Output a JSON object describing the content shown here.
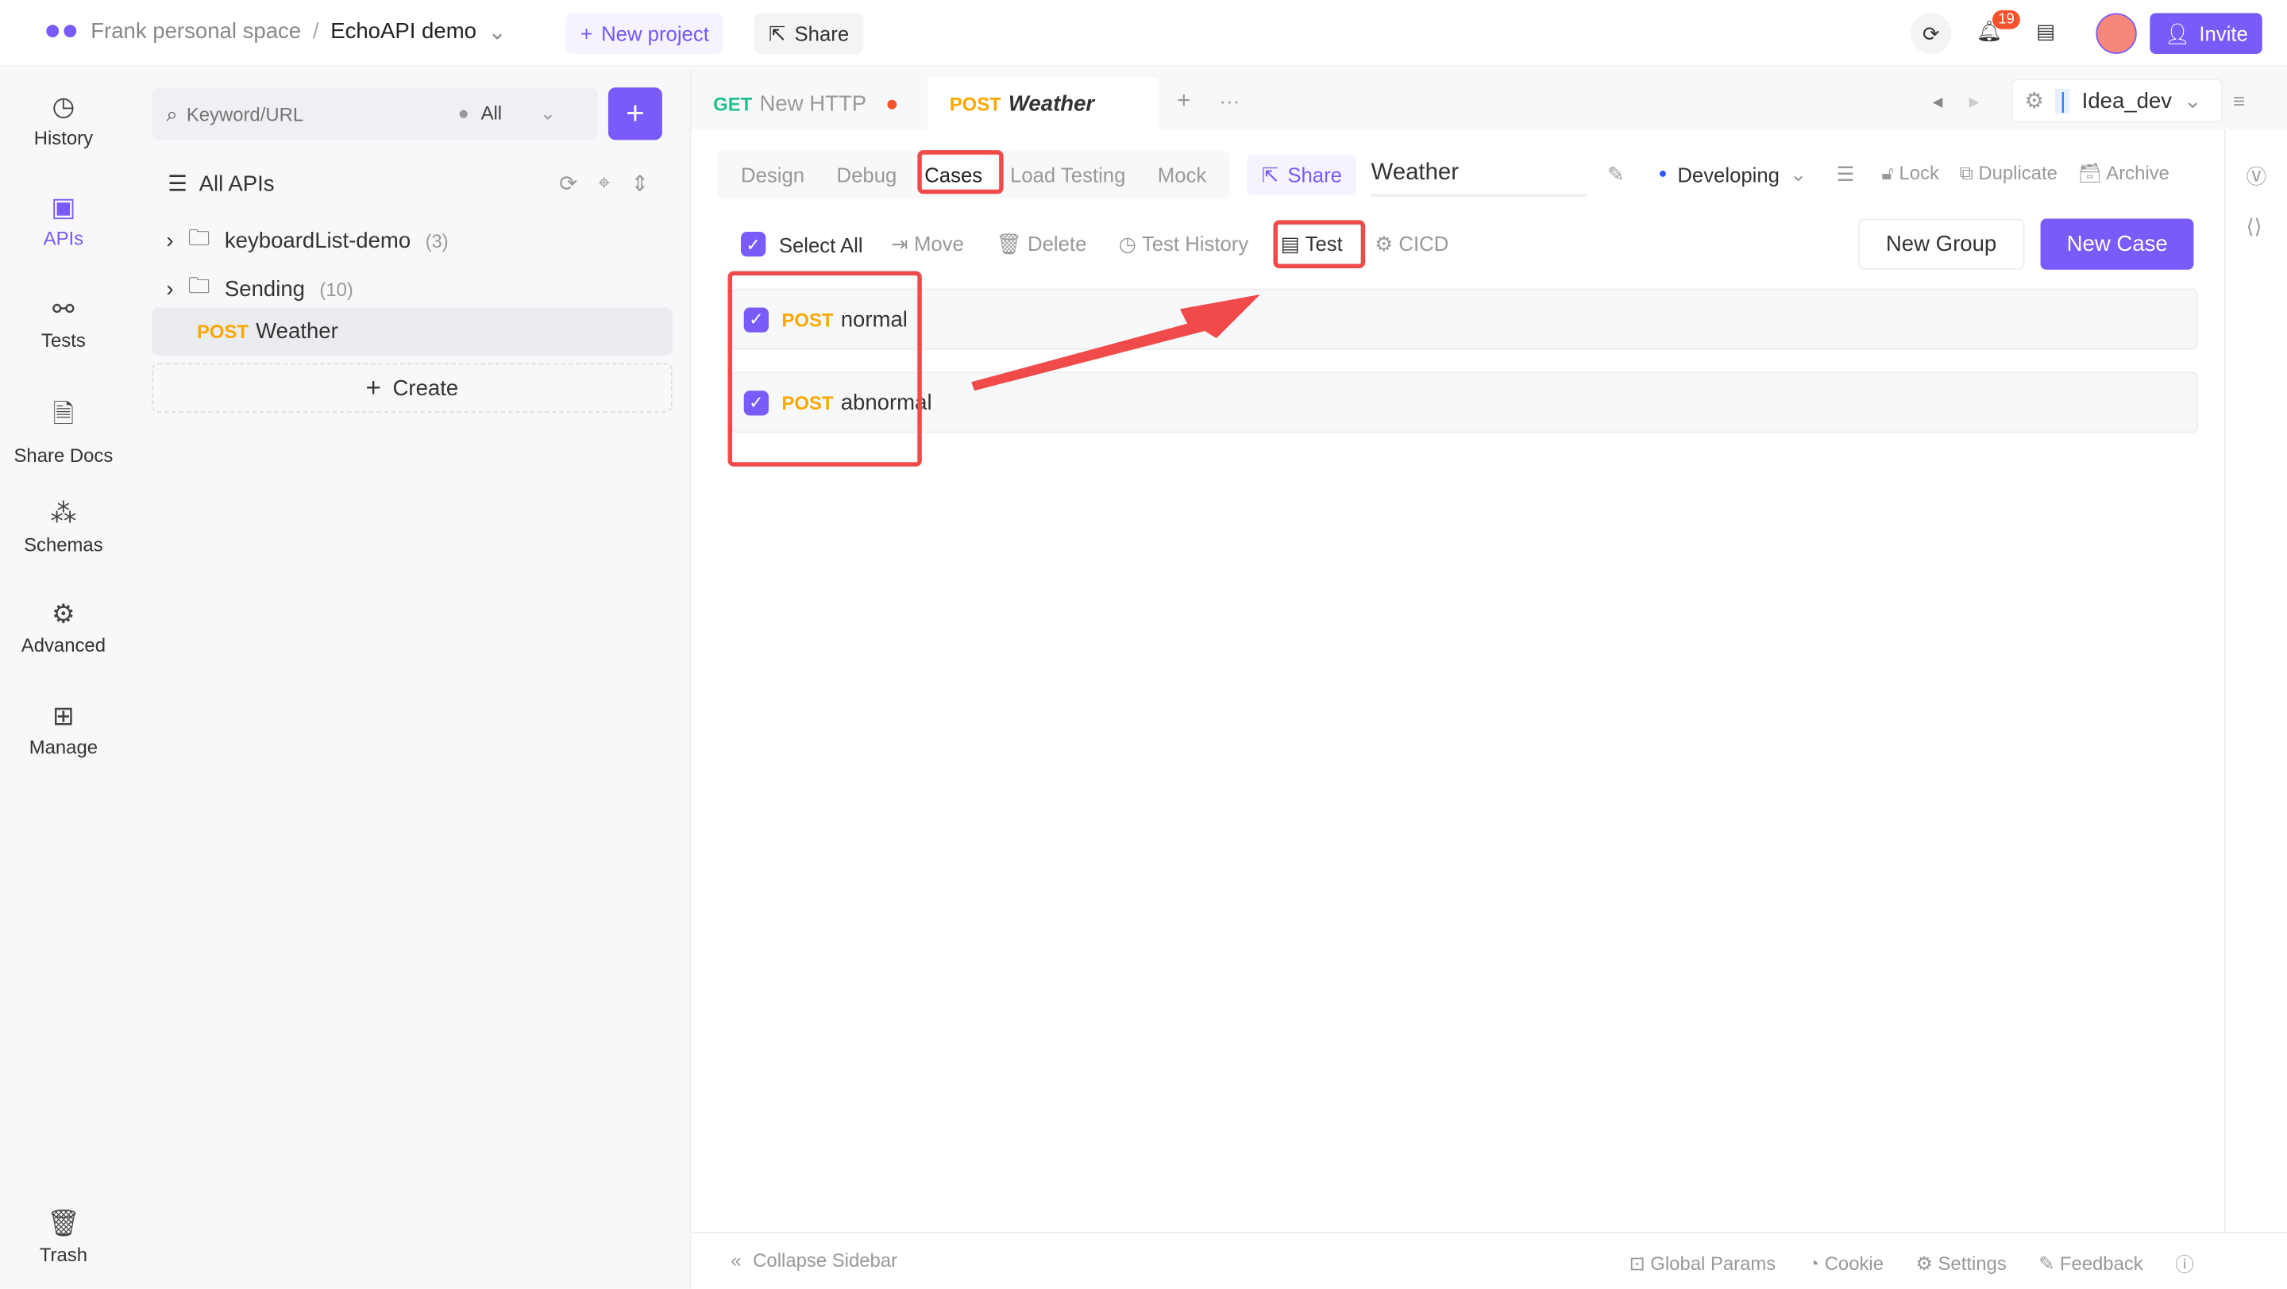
{
  "topbar": {
    "workspace": "Frank personal space",
    "separator": "/",
    "project": "EchoAPI demo",
    "new_project": "New project",
    "share": "Share",
    "notif_count": "19",
    "invite": "Invite"
  },
  "nav": [
    {
      "label": "History",
      "icon": "history-icon"
    },
    {
      "label": "APIs",
      "icon": "apis-icon"
    },
    {
      "label": "Tests",
      "icon": "tests-icon"
    },
    {
      "label": "Share Docs",
      "icon": "docs-icon"
    },
    {
      "label": "Schemas",
      "icon": "schemas-icon"
    },
    {
      "label": "Advanced",
      "icon": "advanced-icon"
    },
    {
      "label": "Manage",
      "icon": "manage-icon"
    },
    {
      "label": "Trash",
      "icon": "trash-icon"
    }
  ],
  "tree": {
    "search_placeholder": "Keyword/URL",
    "filter": "All",
    "all_apis": "All APIs",
    "folders": [
      {
        "name": "keyboardList-demo",
        "count": "(3)"
      },
      {
        "name": "Sending",
        "count": "(10)"
      }
    ],
    "selected": {
      "method": "POST",
      "name": "Weather"
    },
    "create": "Create"
  },
  "tabs": [
    {
      "method": "GET",
      "name": "New HTTP"
    },
    {
      "method": "POST",
      "name": "Weather"
    }
  ],
  "env": "Idea_dev",
  "subtabs": [
    "Design",
    "Debug",
    "Cases",
    "Load Testing",
    "Mock"
  ],
  "subshare": "Share",
  "api_name": "Weather",
  "status": "Developing",
  "actions": [
    "Lock",
    "Duplicate",
    "Archive"
  ],
  "toolbar": {
    "select_all": "Select All",
    "move": "Move",
    "delete": "Delete",
    "test_history": "Test History",
    "test": "Test",
    "cicd": "CICD",
    "new_group": "New Group",
    "new_case": "New Case"
  },
  "cases": [
    {
      "method": "POST",
      "name": "normal"
    },
    {
      "method": "POST",
      "name": "abnormal"
    }
  ],
  "footer": {
    "collapse": "Collapse Sidebar",
    "global_params": "Global Params",
    "cookie": "Cookie",
    "settings": "Settings",
    "feedback": "Feedback"
  },
  "colors": {
    "accent": "#7a5af8",
    "post": "#f9a800",
    "get": "#21c28e",
    "annotation": "#f04a4a"
  }
}
